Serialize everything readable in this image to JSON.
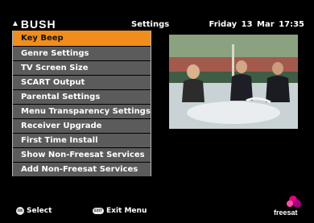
{
  "header": {
    "brand": "BUSH",
    "title": "Settings",
    "datetime": "Friday 13 Mar 17:35"
  },
  "menu": {
    "items": [
      {
        "label": "Key Beep",
        "selected": true
      },
      {
        "label": "Genre Settings",
        "selected": false
      },
      {
        "label": "TV Screen Size",
        "selected": false
      },
      {
        "label": "SCART Output",
        "selected": false
      },
      {
        "label": "Parental Settings",
        "selected": false
      },
      {
        "label": "Menu Transparency Settings",
        "selected": false
      },
      {
        "label": "Receiver Upgrade",
        "selected": false
      },
      {
        "label": "First Time Install",
        "selected": false
      },
      {
        "label": "Show Non-Freesat Services",
        "selected": false
      },
      {
        "label": "Add Non-Freesat Services",
        "selected": false
      }
    ]
  },
  "footer": {
    "ok_icon": "OK",
    "select_label": "Select",
    "exit_icon": "EXIT",
    "exit_label": "Exit Menu",
    "logo_text": "freesat"
  },
  "colors": {
    "selected": "#f08d1d",
    "item": "#5b5b5b",
    "background": "#000000",
    "freesat_pink": "#e6007e"
  }
}
